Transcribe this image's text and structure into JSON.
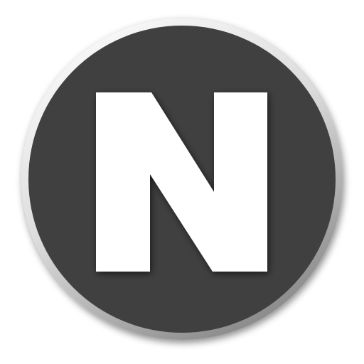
{
  "icon": {
    "letter": "N",
    "colors": {
      "background": "#ffffff",
      "disc_fill": "#404040",
      "rim_light": "#f7f7f7",
      "rim_mid": "#c8c8c8",
      "rim_dark": "#8a8a8a",
      "letter_fill": "#ffffff"
    }
  }
}
